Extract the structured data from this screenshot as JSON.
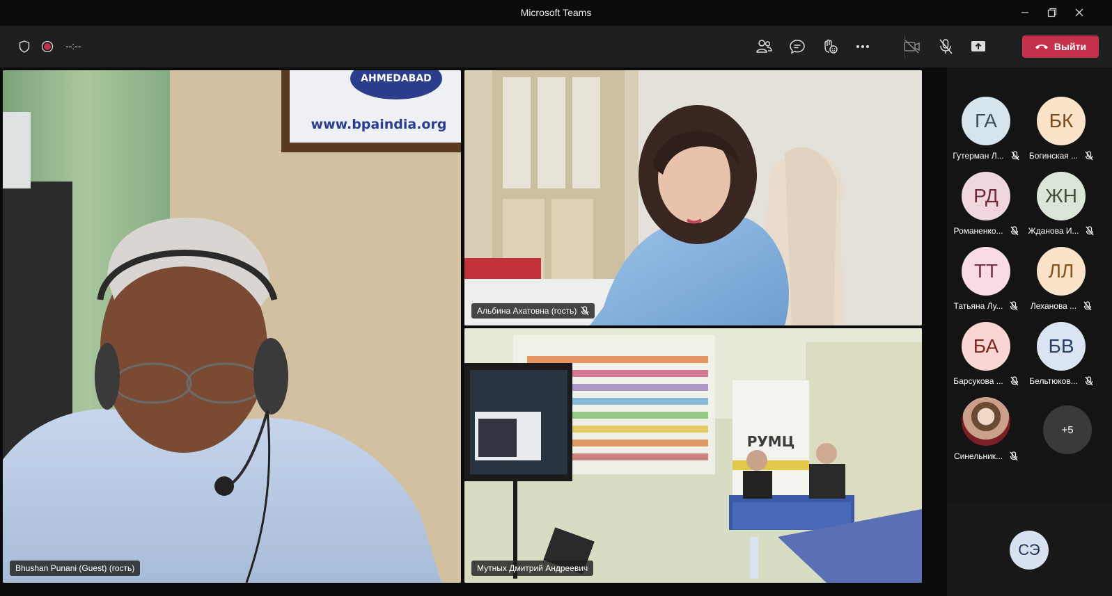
{
  "window": {
    "title": "Microsoft Teams"
  },
  "toolbar": {
    "timer": "--:--",
    "leave_label": "Выйти"
  },
  "tiles": [
    {
      "label": "Bhushan Punani (Guest) (гость)",
      "sign_text": "www.bpaindia.org",
      "sign_seal": "AHMEDABAD"
    },
    {
      "label": "Альбина Ахатовна (гость)"
    },
    {
      "label": "Мутных Дмитрий Андреевич",
      "banner_text": "РУМЦ"
    }
  ],
  "roster": {
    "people": [
      {
        "initials": "ГА",
        "name": "Гутерман Л...",
        "bg": "#d6e4ec",
        "fg": "#3c4d5c"
      },
      {
        "initials": "БК",
        "name": "Богинская ...",
        "bg": "#fbe3c9",
        "fg": "#7a4a1b"
      },
      {
        "initials": "РД",
        "name": "Романенко...",
        "bg": "#f0d6dd",
        "fg": "#6e2c3a"
      },
      {
        "initials": "ЖН",
        "name": "Жданова И...",
        "bg": "#dbe6d8",
        "fg": "#3d4f38"
      },
      {
        "initials": "ТТ",
        "name": "Татьяна Лу...",
        "bg": "#f8dbe3",
        "fg": "#7a3046"
      },
      {
        "initials": "ЛЛ",
        "name": "Леханова ...",
        "bg": "#fbe3c9",
        "fg": "#8a521b"
      },
      {
        "initials": "БА",
        "name": "Барсукова ...",
        "bg": "#f9d5d3",
        "fg": "#7b2a22"
      },
      {
        "initials": "БВ",
        "name": "Бельтюков...",
        "bg": "#dbe4f2",
        "fg": "#2c3f66"
      },
      {
        "initials": "",
        "name": "Синельник...",
        "bg": "#c8b0a0",
        "fg": "#ffffff"
      }
    ],
    "more_count": "+5"
  },
  "self": {
    "initials": "СЭ"
  },
  "colors": {
    "leave": "#c4314b",
    "record": "#c4314b"
  }
}
